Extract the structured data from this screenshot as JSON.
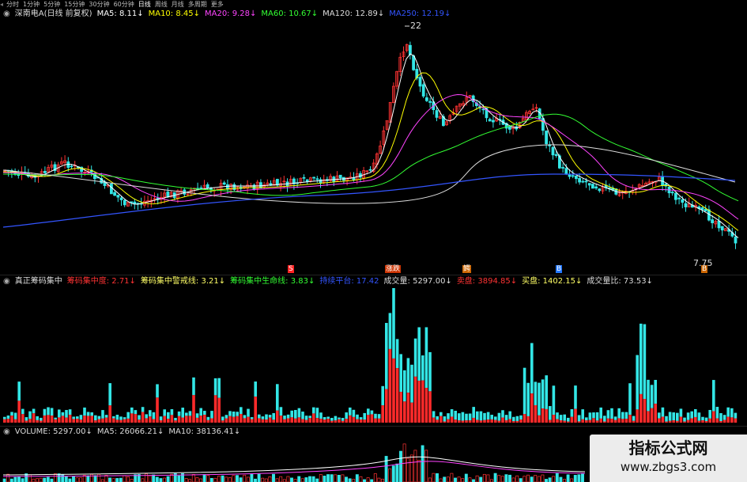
{
  "tabs": [
    {
      "label": "分时",
      "active": false
    },
    {
      "label": "1分钟",
      "active": false
    },
    {
      "label": "5分钟",
      "active": false
    },
    {
      "label": "15分钟",
      "active": false
    },
    {
      "label": "30分钟",
      "active": false
    },
    {
      "label": "60分钟",
      "active": false
    },
    {
      "label": "日线",
      "active": true
    },
    {
      "label": "周线",
      "active": false
    },
    {
      "label": "月线",
      "active": false
    },
    {
      "label": "多周期",
      "active": false
    },
    {
      "label": "更多",
      "active": false
    }
  ],
  "tab_scroll": "◂",
  "main": {
    "title": "深南电A(日线 前复权)",
    "ma": [
      {
        "label": "MA5: 8.11↓",
        "color": "#ffffff"
      },
      {
        "label": "MA10: 8.45↓",
        "color": "#ffff00"
      },
      {
        "label": "MA20: 9.28↓",
        "color": "#ff44ff"
      },
      {
        "label": "MA60: 10.67↓",
        "color": "#33ff33"
      },
      {
        "label": "MA120: 12.89↓",
        "color": "#dddddd"
      },
      {
        "label": "MA250: 12.19↓",
        "color": "#3355ff"
      }
    ],
    "high_label": "22",
    "low_label": "7.75",
    "marks": [
      {
        "label": "S",
        "color": "#ff2222"
      },
      {
        "label": "涨跌",
        "color": "#cc3300"
      },
      {
        "label": "鳄",
        "color": "#cc6600"
      },
      {
        "label": "B",
        "color": "#2277ff"
      },
      {
        "label": "B",
        "color": "#cc6600"
      }
    ]
  },
  "indicator": {
    "title": "真正筹码集中",
    "items": [
      {
        "label": "筹码集中度: 2.71↓",
        "color": "#ff3333"
      },
      {
        "label": "筹码集中警戒线: 3.21↓",
        "color": "#ffff66"
      },
      {
        "label": "筹码集中生命线: 3.83↓",
        "color": "#33ff33"
      },
      {
        "label": "持续平台: 17.42",
        "color": "#3355ff"
      },
      {
        "label": "成交量: 5297.00↓",
        "color": "#dddddd"
      },
      {
        "label": "卖盘: 3894.85↓",
        "color": "#ff3333"
      },
      {
        "label": "买盘: 1402.15↓",
        "color": "#ffff66"
      },
      {
        "label": "成交量比: 73.53↓",
        "color": "#dddddd"
      }
    ]
  },
  "volume": {
    "title": "VOLUME: 5297.00↓",
    "items": [
      {
        "label": "MA5: 26066.21↓",
        "color": "#dddddd"
      },
      {
        "label": "MA10: 38136.41↓",
        "color": "#dddddd"
      }
    ]
  },
  "watermark": {
    "title": "指标公式网",
    "url": "www.zbgs3.com"
  },
  "colors": {
    "up": "#ff3333",
    "down": "#33e6e6",
    "ma5": "#ffffff",
    "ma10": "#ffff00",
    "ma20": "#ff44ff",
    "ma60": "#33ff33",
    "ma120": "#dddddd",
    "ma250": "#3355ff"
  }
}
